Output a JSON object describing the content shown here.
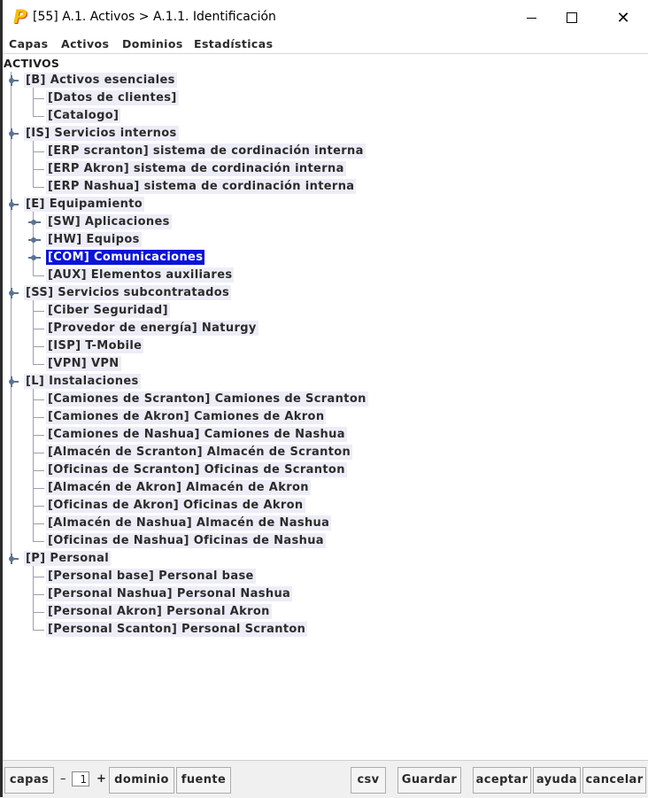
{
  "window": {
    "title": "[55] A.1. Activos > A.1.1. Identificación",
    "app_icon": "P",
    "minimize_symbol": "",
    "close_symbol": "✕"
  },
  "menubar": [
    "Capas",
    "Activos",
    "Dominios",
    "Estadísticas"
  ],
  "tree": {
    "root": "ACTIVOS",
    "nodes": [
      {
        "label": "[B] Activos esenciales",
        "level": 0,
        "expanded": true
      },
      {
        "label": "[Datos de clientes]",
        "level": 1
      },
      {
        "label": "[Catalogo]",
        "level": 1
      },
      {
        "label": "[IS] Servicios internos",
        "level": 0,
        "expanded": true
      },
      {
        "label": "[ERP scranton] sistema de cordinación interna",
        "level": 1
      },
      {
        "label": "[ERP Akron] sistema de cordinación interna",
        "level": 1
      },
      {
        "label": "[ERP Nashua] sistema de cordinación interna",
        "level": 1
      },
      {
        "label": "[E] Equipamiento",
        "level": 0,
        "expanded": true
      },
      {
        "label": "[SW] Aplicaciones",
        "level": 1,
        "collapsed": true
      },
      {
        "label": "[HW] Equipos",
        "level": 1,
        "collapsed": true
      },
      {
        "label": "[COM] Comunicaciones",
        "level": 1,
        "collapsed": true,
        "selected": true
      },
      {
        "label": "[AUX] Elementos auxiliares",
        "level": 1
      },
      {
        "label": "[SS] Servicios subcontratados",
        "level": 0,
        "expanded": true
      },
      {
        "label": "[Ciber Seguridad]",
        "level": 1
      },
      {
        "label": "[Provedor de energía] Naturgy",
        "level": 1
      },
      {
        "label": "[ISP] T-Mobile",
        "level": 1
      },
      {
        "label": "[VPN] VPN",
        "level": 1
      },
      {
        "label": "[L] Instalaciones",
        "level": 0,
        "expanded": true
      },
      {
        "label": "[Camiones de Scranton] Camiones de Scranton",
        "level": 1
      },
      {
        "label": "[Camiones de Akron] Camiones de Akron",
        "level": 1
      },
      {
        "label": "[Camiones de Nashua] Camiones de Nashua",
        "level": 1
      },
      {
        "label": "[Almacén de Scranton] Almacén de Scranton",
        "level": 1
      },
      {
        "label": "[Oficinas de Scranton] Oficinas de Scranton",
        "level": 1
      },
      {
        "label": "[Almacén de Akron] Almacén de Akron",
        "level": 1
      },
      {
        "label": "[Oficinas de Akron] Oficinas de Akron",
        "level": 1
      },
      {
        "label": "[Almacén de Nashua] Almacén de Nashua",
        "level": 1
      },
      {
        "label": "[Oficinas de Nashua] Oficinas de Nashua",
        "level": 1
      },
      {
        "label": "[P] Personal",
        "level": 0,
        "expanded": true
      },
      {
        "label": "[Personal base] Personal base",
        "level": 1
      },
      {
        "label": "[Personal Nashua] Personal Nashua",
        "level": 1
      },
      {
        "label": "[Personal Akron] Personal Akron",
        "level": 1
      },
      {
        "label": "[Personal Scanton] Personal Scranton",
        "level": 1
      }
    ]
  },
  "bottombar": {
    "capas": "capas",
    "stepper_minus": "–",
    "stepper_value": "1",
    "stepper_plus": "+",
    "dominio": "dominio",
    "fuente": "fuente",
    "csv": "csv",
    "guardar": "Guardar",
    "aceptar": "aceptar",
    "ayuda": "ayuda",
    "cancelar": "cancelar"
  }
}
